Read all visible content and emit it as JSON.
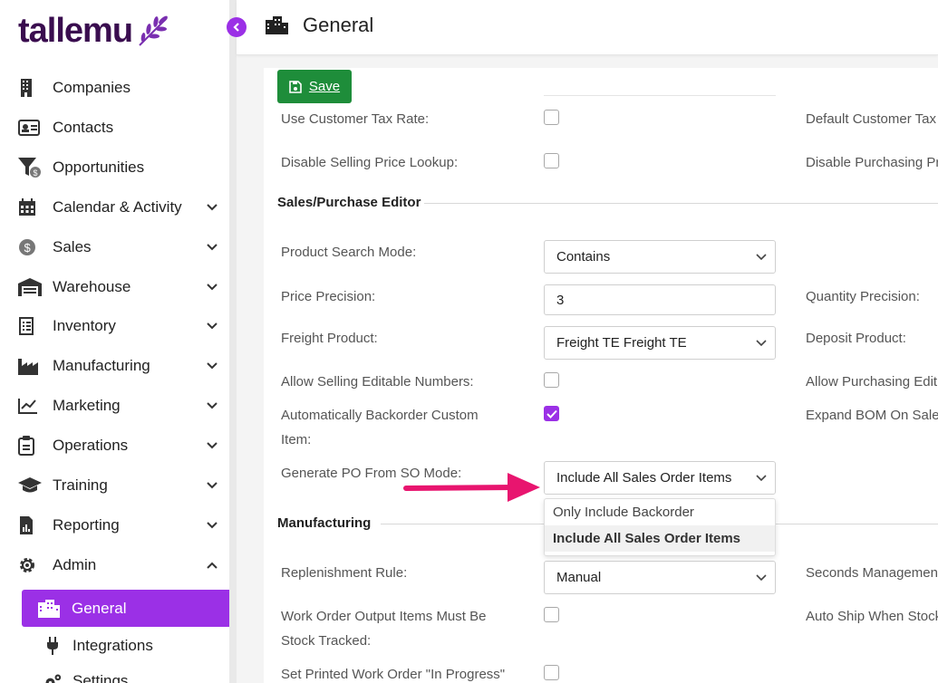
{
  "brand": {
    "name": "tallemu",
    "accent": "#9b30e6",
    "logo_color": "#3a0d4f"
  },
  "sidebar": {
    "items": [
      {
        "label": "Companies",
        "icon": "building-icon",
        "expandable": false
      },
      {
        "label": "Contacts",
        "icon": "contact-card-icon",
        "expandable": false
      },
      {
        "label": "Opportunities",
        "icon": "funnel-dollar-icon",
        "expandable": false
      },
      {
        "label": "Calendar & Activity",
        "icon": "calendar-icon",
        "expandable": true
      },
      {
        "label": "Sales",
        "icon": "dollar-coin-icon",
        "expandable": true
      },
      {
        "label": "Warehouse",
        "icon": "warehouse-icon",
        "expandable": true
      },
      {
        "label": "Inventory",
        "icon": "clipboard-list-icon",
        "expandable": true
      },
      {
        "label": "Manufacturing",
        "icon": "factory-icon",
        "expandable": true
      },
      {
        "label": "Marketing",
        "icon": "chart-line-icon",
        "expandable": true
      },
      {
        "label": "Operations",
        "icon": "clipboard-check-icon",
        "expandable": true
      },
      {
        "label": "Training",
        "icon": "graduation-cap-icon",
        "expandable": true
      },
      {
        "label": "Reporting",
        "icon": "report-chart-icon",
        "expandable": true
      },
      {
        "label": "Admin",
        "icon": "gear-icon",
        "expandable": true,
        "expanded": true
      }
    ],
    "admin_sub": {
      "active": {
        "label": "General",
        "icon": "building-icon"
      },
      "integrations": {
        "label": "Integrations",
        "icon": "plug-icon"
      },
      "settings": {
        "label": "Settings",
        "icon": "gears-icon"
      }
    }
  },
  "header": {
    "title": "General",
    "icon": "building-icon"
  },
  "toolbar": {
    "save_label": "Save"
  },
  "form": {
    "use_customer_tax_rate": {
      "label": "Use Customer Tax Rate:",
      "checked": false
    },
    "default_customer_tax": {
      "label": "Default Customer Tax"
    },
    "disable_selling_price_lookup": {
      "label": "Disable Selling Price Lookup:",
      "checked": false
    },
    "disable_purchasing": {
      "label": "Disable Purchasing Pr"
    },
    "section_sales_purchase": "Sales/Purchase Editor",
    "product_search_mode": {
      "label": "Product Search Mode:",
      "value": "Contains"
    },
    "price_precision": {
      "label": "Price Precision:",
      "value": "3"
    },
    "quantity_precision": {
      "label": "Quantity Precision:"
    },
    "freight_product": {
      "label": "Freight Product:",
      "value": "Freight TE Freight TE"
    },
    "deposit_product": {
      "label": "Deposit Product:"
    },
    "allow_selling_editable_numbers": {
      "label": "Allow Selling Editable Numbers:",
      "checked": false
    },
    "allow_purchasing_edit": {
      "label": "Allow Purchasing Edit"
    },
    "auto_backorder_line1": "Automatically Backorder Custom",
    "auto_backorder_line2": "Item:",
    "auto_backorder_checked": true,
    "expand_bom": {
      "label": "Expand BOM On Sale:"
    },
    "generate_po_mode": {
      "label": "Generate PO From SO Mode:",
      "value": "Include All Sales Order Items",
      "options": [
        "Only Include Backorder",
        "Include All Sales Order Items"
      ]
    },
    "section_manufacturing": "Manufacturing",
    "replenishment_rule": {
      "label": "Replenishment Rule:",
      "value": "Manual"
    },
    "seconds_management": {
      "label": "Seconds Management"
    },
    "wo_output_line1": "Work Order Output Items Must Be",
    "wo_output_line2": "Stock Tracked:",
    "wo_output_checked": false,
    "auto_ship": {
      "label": "Auto Ship When Stock"
    },
    "set_printed_wo": {
      "label": "Set Printed Work Order \"In Progress\"",
      "checked": false
    }
  },
  "annotation": {
    "arrow_color": "#e8156f"
  }
}
